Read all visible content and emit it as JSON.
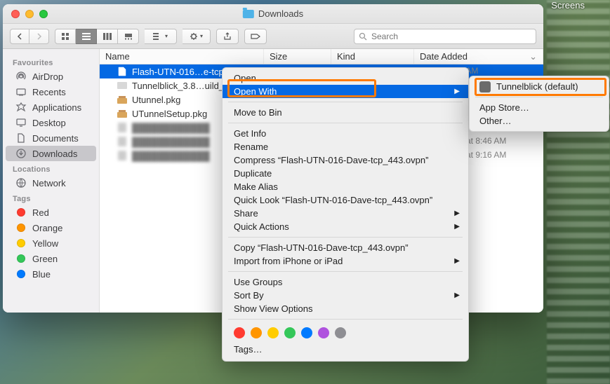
{
  "window": {
    "title": "Downloads"
  },
  "toolbar": {
    "search_placeholder": "Search"
  },
  "sidebar": {
    "sections": [
      {
        "header": "Favourites",
        "items": [
          {
            "icon": "airdrop",
            "label": "AirDrop"
          },
          {
            "icon": "recents",
            "label": "Recents"
          },
          {
            "icon": "apps",
            "label": "Applications"
          },
          {
            "icon": "desktop",
            "label": "Desktop"
          },
          {
            "icon": "documents",
            "label": "Documents"
          },
          {
            "icon": "downloads",
            "label": "Downloads",
            "selected": true
          }
        ]
      },
      {
        "header": "Locations",
        "items": [
          {
            "icon": "network",
            "label": "Network"
          }
        ]
      },
      {
        "header": "Tags",
        "items": [
          {
            "icon": "dot",
            "color": "#ff3b30",
            "label": "Red"
          },
          {
            "icon": "dot",
            "color": "#ff9500",
            "label": "Orange"
          },
          {
            "icon": "dot",
            "color": "#ffcc00",
            "label": "Yellow"
          },
          {
            "icon": "dot",
            "color": "#34c759",
            "label": "Green"
          },
          {
            "icon": "dot",
            "color": "#007aff",
            "label": "Blue"
          }
        ]
      }
    ]
  },
  "columns": {
    "name": "Name",
    "size": "Size",
    "kind": "Kind",
    "date": "Date Added"
  },
  "files": [
    {
      "name": "Flash-UTN-016…e-tcp_443.ovpn",
      "selected": true,
      "date_hint": "3 AM"
    },
    {
      "name": "Tunnelblick_3.8…uild_5400.dmg"
    },
    {
      "name": "Utunnel.pkg"
    },
    {
      "name": "UTunnelSetup.pkg"
    },
    {
      "name": "obscured-entry-1",
      "blur": true
    },
    {
      "name": "obscured-entry-2",
      "blur": true,
      "date_hint": "0 at 8:46 AM"
    },
    {
      "name": "obscured-entry-3",
      "blur": true,
      "date_hint": "0 at 9:16 AM"
    }
  ],
  "context_menu": {
    "groups": [
      [
        {
          "label": "Open"
        },
        {
          "label": "Open With",
          "submenu": true,
          "highlight": true
        }
      ],
      [
        {
          "label": "Move to Bin"
        }
      ],
      [
        {
          "label": "Get Info"
        },
        {
          "label": "Rename"
        },
        {
          "label": "Compress “Flash-UTN-016-Dave-tcp_443.ovpn”"
        },
        {
          "label": "Duplicate"
        },
        {
          "label": "Make Alias"
        },
        {
          "label": "Quick Look “Flash-UTN-016-Dave-tcp_443.ovpn”"
        },
        {
          "label": "Share",
          "submenu": true
        },
        {
          "label": "Quick Actions",
          "submenu": true
        }
      ],
      [
        {
          "label": "Copy “Flash-UTN-016-Dave-tcp_443.ovpn”"
        },
        {
          "label": "Import from iPhone or iPad",
          "submenu": true
        }
      ],
      [
        {
          "label": "Use Groups"
        },
        {
          "label": "Sort By",
          "submenu": true
        },
        {
          "label": "Show View Options"
        }
      ]
    ],
    "tags_label": "Tags…",
    "tag_colors": [
      "#ff3b30",
      "#ff9500",
      "#ffcc00",
      "#34c759",
      "#007aff",
      "#af52de",
      "#8e8e93"
    ]
  },
  "submenu": {
    "items": [
      {
        "label": "Tunnelblick (default)",
        "icon": true
      },
      {
        "sep": true
      },
      {
        "label": "App Store…"
      },
      {
        "label": "Other…"
      }
    ]
  },
  "menubar_hint": "Screens"
}
